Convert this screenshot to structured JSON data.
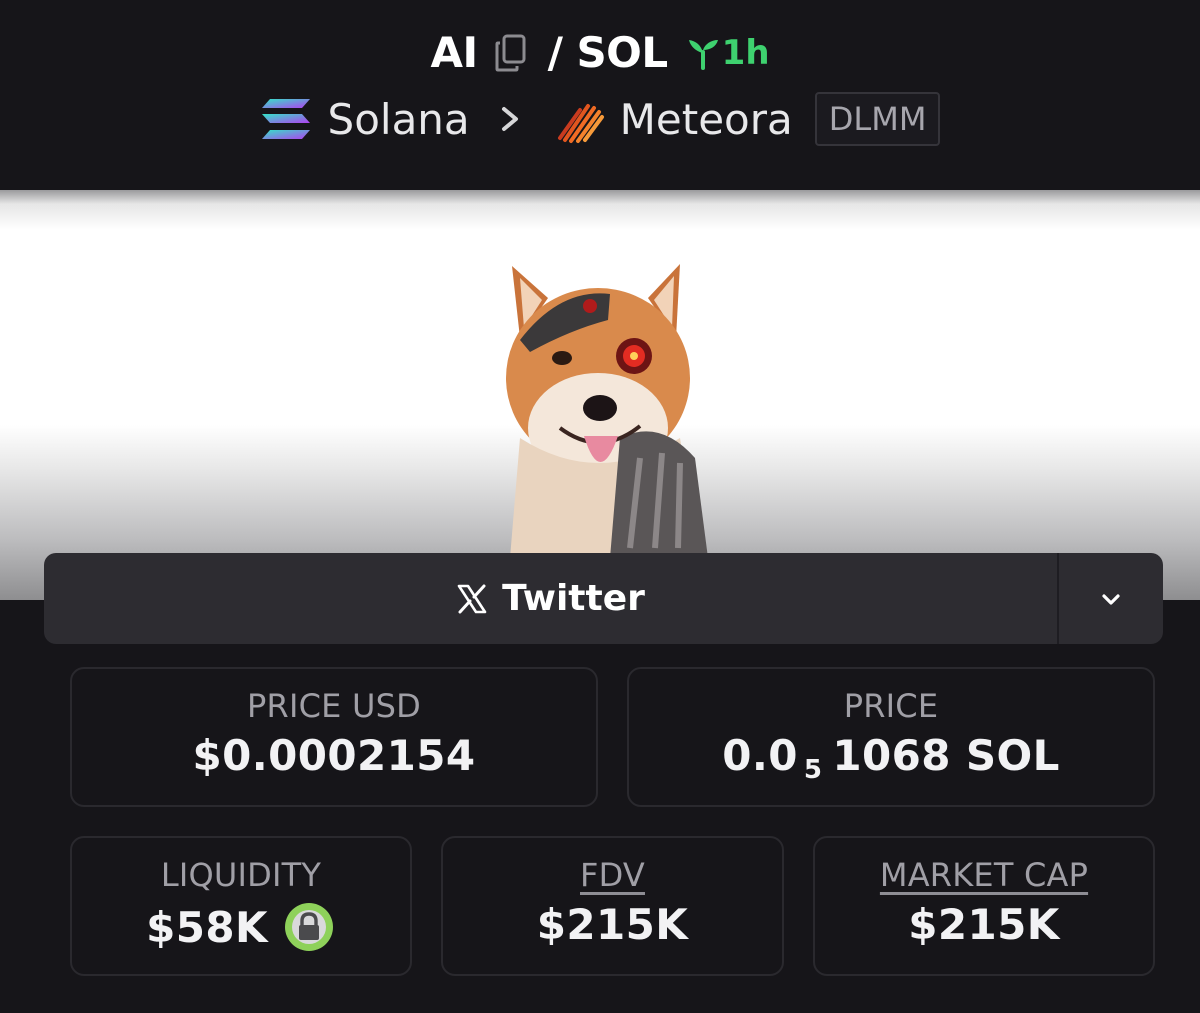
{
  "pair": {
    "base": "AI",
    "separator": "/",
    "quote": "SOL",
    "age": "1h"
  },
  "breadcrumb": {
    "chain": "Solana",
    "dex": "Meteora",
    "badge": "DLMM"
  },
  "social": {
    "label": "Twitter"
  },
  "stats": {
    "price_usd": {
      "label": "PRICE USD",
      "value": "$0.0002154"
    },
    "price_native": {
      "label": "PRICE",
      "value_prefix": "0.0",
      "zeros": "5",
      "value_suffix": "1068 SOL"
    },
    "liquidity": {
      "label": "LIQUIDITY",
      "value": "$58K"
    },
    "fdv": {
      "label": "FDV",
      "value": "$215K"
    },
    "market_cap": {
      "label": "MARKET CAP",
      "value": "$215K"
    }
  },
  "icons": [
    "copy-icon",
    "sprout-icon",
    "solana-icon",
    "chevron-right-icon",
    "meteora-icon",
    "x-icon",
    "chevron-down-icon",
    "lock-icon"
  ],
  "colors": {
    "background": "#161519",
    "age_green": "#3ed16f",
    "lock_green": "#8ed15a"
  }
}
